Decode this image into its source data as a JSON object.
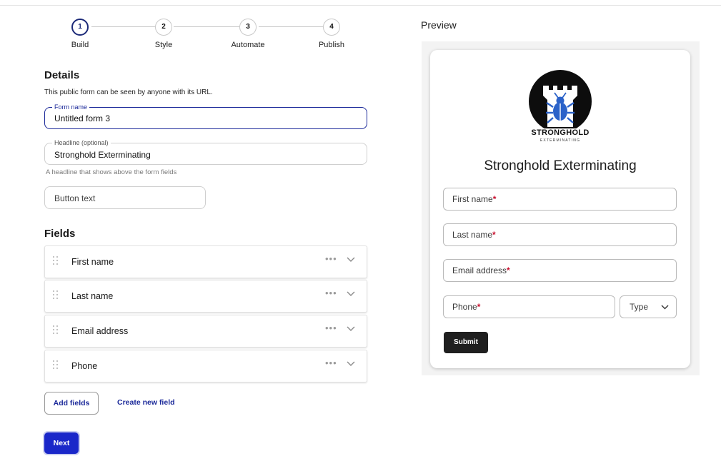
{
  "stepper": {
    "steps": [
      {
        "number": "1",
        "label": "Build",
        "active": true
      },
      {
        "number": "2",
        "label": "Style",
        "active": false
      },
      {
        "number": "3",
        "label": "Automate",
        "active": false
      },
      {
        "number": "4",
        "label": "Publish",
        "active": false
      }
    ]
  },
  "details": {
    "title": "Details",
    "description": "This public form can be seen by anyone with its URL.",
    "form_name": {
      "label": "Form name",
      "value": "Untitled form 3"
    },
    "headline": {
      "label": "Headline (optional)",
      "value": "Stronghold Exterminating",
      "helper": "A headline that shows above the form fields"
    },
    "button_text": {
      "placeholder": "Button text"
    }
  },
  "fields": {
    "title": "Fields",
    "items": [
      {
        "label": "First name"
      },
      {
        "label": "Last name"
      },
      {
        "label": "Email address"
      },
      {
        "label": "Phone"
      }
    ],
    "more_icon": "more-horizontal-icon",
    "expand_icon": "chevron-down-icon",
    "drag_icon": "drag-handle-icon"
  },
  "actions": {
    "add_fields": "Add fields",
    "create_new_field": "Create new field",
    "next": "Next"
  },
  "preview": {
    "title": "Preview",
    "logo": {
      "name": "STRONGHOLD",
      "tagline": "EXTERMINATING",
      "icon": "castle-bug-logo"
    },
    "headline": "Stronghold Exterminating",
    "inputs": [
      {
        "placeholder": "First name",
        "required_mark": "*"
      },
      {
        "placeholder": "Last name",
        "required_mark": "*"
      },
      {
        "placeholder": "Email address",
        "required_mark": "*"
      },
      {
        "placeholder": "Phone",
        "required_mark": "*"
      }
    ],
    "phone_type": "Type",
    "submit": "Submit"
  },
  "colors": {
    "accent": "#1a27c9",
    "link": "#1c2a9a",
    "required": "#c8102e",
    "submit_bg": "#1f1f1f"
  }
}
